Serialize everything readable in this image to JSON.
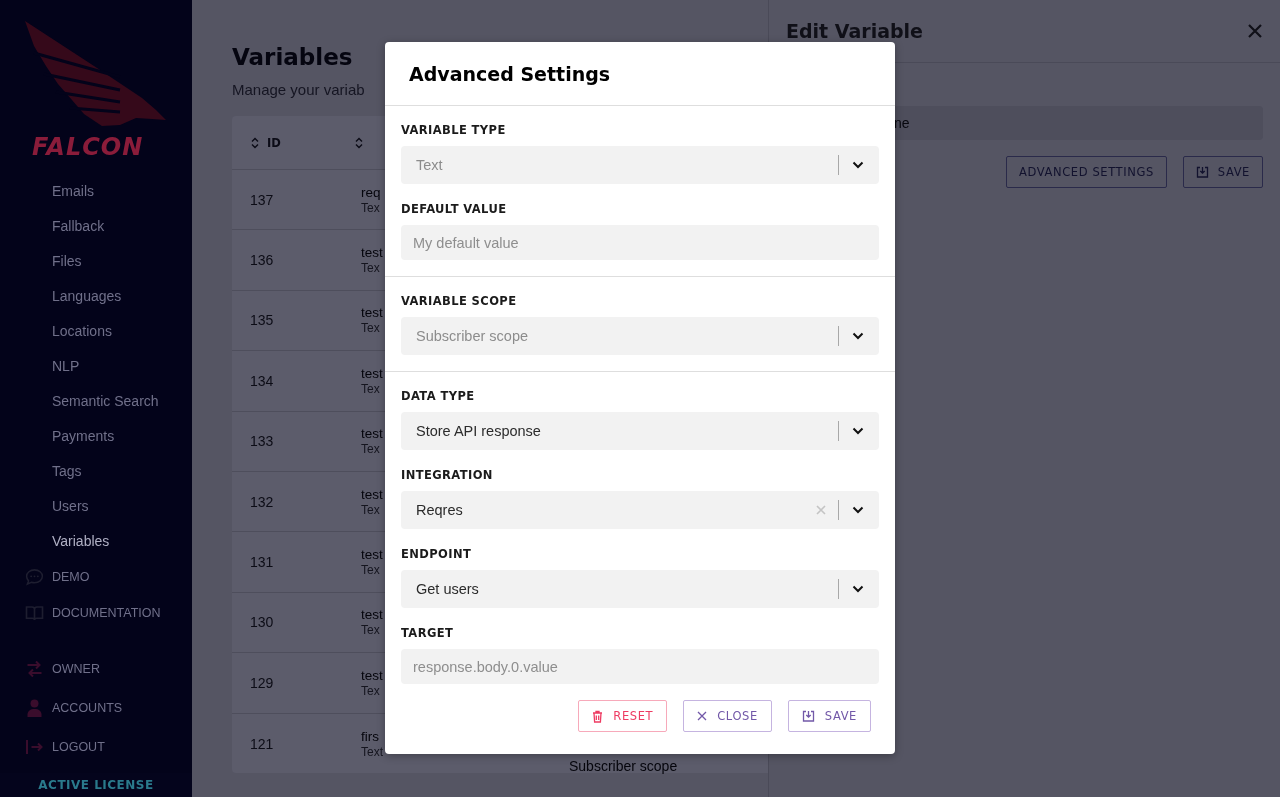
{
  "sidebar": {
    "logo_text": "FALCON",
    "items": [
      {
        "label": "Emails",
        "selected": false
      },
      {
        "label": "Fallback",
        "selected": false
      },
      {
        "label": "Files",
        "selected": false
      },
      {
        "label": "Languages",
        "selected": false
      },
      {
        "label": "Locations",
        "selected": false
      },
      {
        "label": "NLP",
        "selected": false
      },
      {
        "label": "Semantic Search",
        "selected": false
      },
      {
        "label": "Payments",
        "selected": false
      },
      {
        "label": "Tags",
        "selected": false
      },
      {
        "label": "Users",
        "selected": false
      },
      {
        "label": "Variables",
        "selected": true
      }
    ],
    "links": [
      {
        "label": "DEMO",
        "kind": "chat"
      },
      {
        "label": "DOCUMENTATION",
        "kind": "book"
      }
    ],
    "account_links": [
      {
        "label": "OWNER",
        "kind": "swap"
      },
      {
        "label": "ACCOUNTS",
        "kind": "person"
      },
      {
        "label": "LOGOUT",
        "kind": "logout"
      }
    ],
    "license": "ACTIVE LICENSE"
  },
  "page": {
    "title": "Variables",
    "subtitle": "Manage your variab",
    "table": {
      "columns": [
        "ID"
      ],
      "rows": [
        {
          "id": "137",
          "name": "req",
          "type": "Tex"
        },
        {
          "id": "136",
          "name": "test",
          "type": "Tex"
        },
        {
          "id": "135",
          "name": "test",
          "type": "Tex"
        },
        {
          "id": "134",
          "name": "test",
          "type": "Tex"
        },
        {
          "id": "133",
          "name": "test",
          "type": "Tex"
        },
        {
          "id": "132",
          "name": "test",
          "type": "Tex"
        },
        {
          "id": "131",
          "name": "test",
          "type": "Tex"
        },
        {
          "id": "130",
          "name": "test",
          "type": "Tex"
        },
        {
          "id": "129",
          "name": "test",
          "type": "Tex"
        },
        {
          "id": "121",
          "name": "firs",
          "type": "Text",
          "scope": "Subscriber scope"
        }
      ]
    }
  },
  "drawer": {
    "title": "Edit Variable",
    "name_value": "ne",
    "buttons": [
      {
        "label": "ADVANCED SETTINGS",
        "kind": "plain"
      },
      {
        "label": "SAVE",
        "kind": "save"
      }
    ]
  },
  "modal": {
    "title": "Advanced Settings",
    "sections": [
      {
        "fields": [
          {
            "label": "VARIABLE TYPE",
            "kind": "select",
            "value": "Text",
            "disabled": true,
            "clearable": false
          },
          {
            "label": "DEFAULT VALUE",
            "kind": "input",
            "placeholder": "My default value"
          }
        ]
      },
      {
        "fields": [
          {
            "label": "VARIABLE SCOPE",
            "kind": "select",
            "value": "Subscriber scope",
            "disabled": true,
            "clearable": false
          }
        ]
      },
      {
        "fields": [
          {
            "label": "DATA TYPE",
            "kind": "select",
            "value": "Store API response",
            "disabled": false,
            "clearable": false
          },
          {
            "label": "INTEGRATION",
            "kind": "select",
            "value": "Reqres",
            "disabled": false,
            "clearable": true
          },
          {
            "label": "ENDPOINT",
            "kind": "select",
            "value": "Get users",
            "disabled": false,
            "clearable": false
          },
          {
            "label": "TARGET",
            "kind": "input",
            "placeholder": "response.body.0.value"
          }
        ]
      }
    ],
    "buttons": [
      {
        "label": "RESET",
        "kind": "reset"
      },
      {
        "label": "CLOSE",
        "kind": "close"
      },
      {
        "label": "SAVE",
        "kind": "save"
      }
    ]
  }
}
